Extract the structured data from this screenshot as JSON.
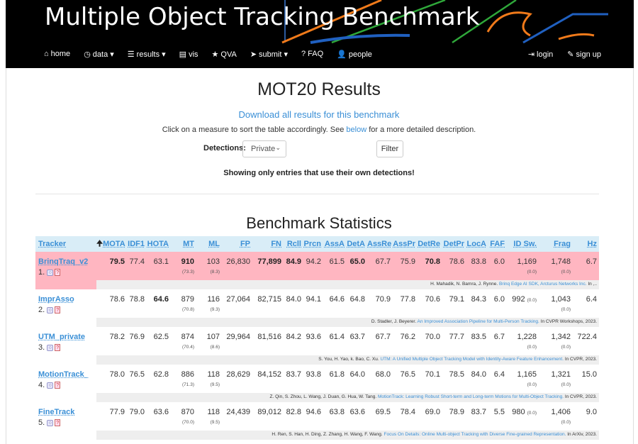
{
  "header": {
    "title": "Multiple Object Tracking Benchmark",
    "nav": [
      {
        "icon": "home-icon",
        "glyph": "⌂",
        "label": "home"
      },
      {
        "icon": "dashboard-icon",
        "glyph": "◷",
        "label": "data ▾"
      },
      {
        "icon": "list-icon",
        "glyph": "☰",
        "label": "results ▾"
      },
      {
        "icon": "film-icon",
        "glyph": "▤",
        "label": "vis"
      },
      {
        "icon": "star-icon",
        "glyph": "★",
        "label": "QVA"
      },
      {
        "icon": "send-icon",
        "glyph": "➤",
        "label": "submit ▾"
      },
      {
        "icon": "question-icon",
        "glyph": "?",
        "label": "FAQ"
      },
      {
        "icon": "user-icon",
        "glyph": "👤",
        "label": "people"
      }
    ],
    "nav_right": [
      {
        "icon": "login-icon",
        "glyph": "⇥",
        "label": "login"
      },
      {
        "icon": "pencil-icon",
        "glyph": "✎",
        "label": "sign up"
      }
    ]
  },
  "page": {
    "title": "MOT20 Results",
    "download": "Download all results for this benchmark",
    "help_pre": "Click on a measure to sort the table accordingly. See ",
    "help_link": "below",
    "help_post": " for a more detailed description.",
    "detections_label": "Detections:",
    "detections_value": "Private",
    "filter_label": "Filter",
    "notice": "Showing only entries that use their own detections!",
    "stats_title": "Benchmark Statistics"
  },
  "colors": {
    "header_bg": "#000000",
    "accent": "#3a8fd6",
    "table_header": "#d9edf7",
    "highlight": "#ffb6c1"
  },
  "table": {
    "columns": [
      "Tracker",
      "MOTA",
      "IDF1",
      "HOTA",
      "MT",
      "ML",
      "FP",
      "FN",
      "Rcll",
      "Prcn",
      "AssA",
      "DetA",
      "AssRe",
      "AssPr",
      "DetRe",
      "DetPr",
      "LocA",
      "FAF",
      "ID Sw.",
      "Frag",
      "Hz"
    ],
    "sorted_column": "MOTA",
    "rows": [
      {
        "name": "BrinqTraq_v2",
        "rank": "1.",
        "highlight": true,
        "values": [
          "79.5",
          "77.4",
          "63.1",
          "910",
          "103",
          "26,830",
          "77,899",
          "84.9",
          "94.2",
          "61.5",
          "65.0",
          "67.7",
          "75.9",
          "70.8",
          "78.6",
          "83.8",
          "6.0",
          "1,169",
          "1,748",
          "6.7"
        ],
        "bold": [
          0,
          3,
          6,
          7,
          10,
          13
        ],
        "mt_sub": "(73.3)",
        "ml_sub": "(8.3)",
        "idsw_sub": "(0.0)",
        "frag_sub": "(0.0)",
        "cite": {
          "authors": "H. Mahadik, N. Bamra, J. Rynne. ",
          "title": "Brinq Edge AI SDK, Arcturus Networks Inc.",
          "venue": " In ,.."
        }
      },
      {
        "name": "ImprAsso",
        "rank": "2.",
        "highlight": false,
        "values": [
          "78.6",
          "78.8",
          "64.6",
          "879",
          "116",
          "27,064",
          "82,715",
          "84.0",
          "94.1",
          "64.6",
          "64.8",
          "70.9",
          "77.8",
          "70.6",
          "79.1",
          "84.3",
          "6.0",
          "992",
          "1,043",
          "6.4"
        ],
        "bold": [
          2
        ],
        "mt_sub": "(70.8)",
        "ml_sub": "(9.3)",
        "idsw_sub": "(0.0)",
        "frag_sub": "(0.0)",
        "cite": {
          "authors": "D. Stadler, J. Beyerer. ",
          "title": "An Improved Association Pipeline for Multi-Person Tracking.",
          "venue": " In CVPR Workshops, 2023."
        }
      },
      {
        "name": "UTM_private",
        "rank": "3.",
        "highlight": false,
        "values": [
          "78.2",
          "76.9",
          "62.5",
          "874",
          "107",
          "29,964",
          "81,516",
          "84.2",
          "93.6",
          "61.4",
          "63.7",
          "67.7",
          "76.2",
          "70.0",
          "77.7",
          "83.5",
          "6.7",
          "1,228",
          "1,342",
          "722.4"
        ],
        "bold": [],
        "mt_sub": "(70.4)",
        "ml_sub": "(8.6)",
        "idsw_sub": "(0.0)",
        "frag_sub": "(0.0)",
        "cite": {
          "authors": "S. You, H. Yao, k. Bao, C. Xu. ",
          "title": "UTM: A Unified Multiple Object Tracking Model with Identity-Aware Feature Enhancement.",
          "venue": " In CVPR, 2023."
        }
      },
      {
        "name": "MotionTrack_",
        "rank": "4.",
        "highlight": false,
        "values": [
          "78.0",
          "76.5",
          "62.8",
          "886",
          "118",
          "28,629",
          "84,152",
          "83.7",
          "93.8",
          "61.8",
          "64.0",
          "68.0",
          "76.5",
          "70.1",
          "78.5",
          "84.0",
          "6.4",
          "1,165",
          "1,321",
          "15.0"
        ],
        "bold": [],
        "mt_sub": "(71.3)",
        "ml_sub": "(9.5)",
        "idsw_sub": "(0.0)",
        "frag_sub": "(0.0)",
        "cite": {
          "authors": "Z. Qin, S. Zhou, L. Wang, J. Duan, G. Hua, W. Tang. ",
          "title": "MotionTrack: Learning Robust Short-term and Long-term Motions for Multi-Object Tracking.",
          "venue": " In CVPR, 2023."
        }
      },
      {
        "name": "FineTrack",
        "rank": "5.",
        "highlight": false,
        "values": [
          "77.9",
          "79.0",
          "63.6",
          "870",
          "118",
          "24,439",
          "89,012",
          "82.8",
          "94.6",
          "63.8",
          "63.6",
          "69.5",
          "78.4",
          "69.0",
          "78.9",
          "83.7",
          "5.5",
          "980",
          "1,406",
          "9.0"
        ],
        "bold": [],
        "mt_sub": "(70.0)",
        "ml_sub": "(9.5)",
        "idsw_sub": "(0.0)",
        "frag_sub": "(0.0)",
        "cite": {
          "authors": "H. Ren, S. Han, H. Ding, Z. Zhang, H. Wang, F. Wang. ",
          "title": "Focus On Details: Online Multi-object Tracking with Diverse Fine-grained Representation.",
          "venue": " In ArXiv, 2023."
        }
      }
    ]
  }
}
